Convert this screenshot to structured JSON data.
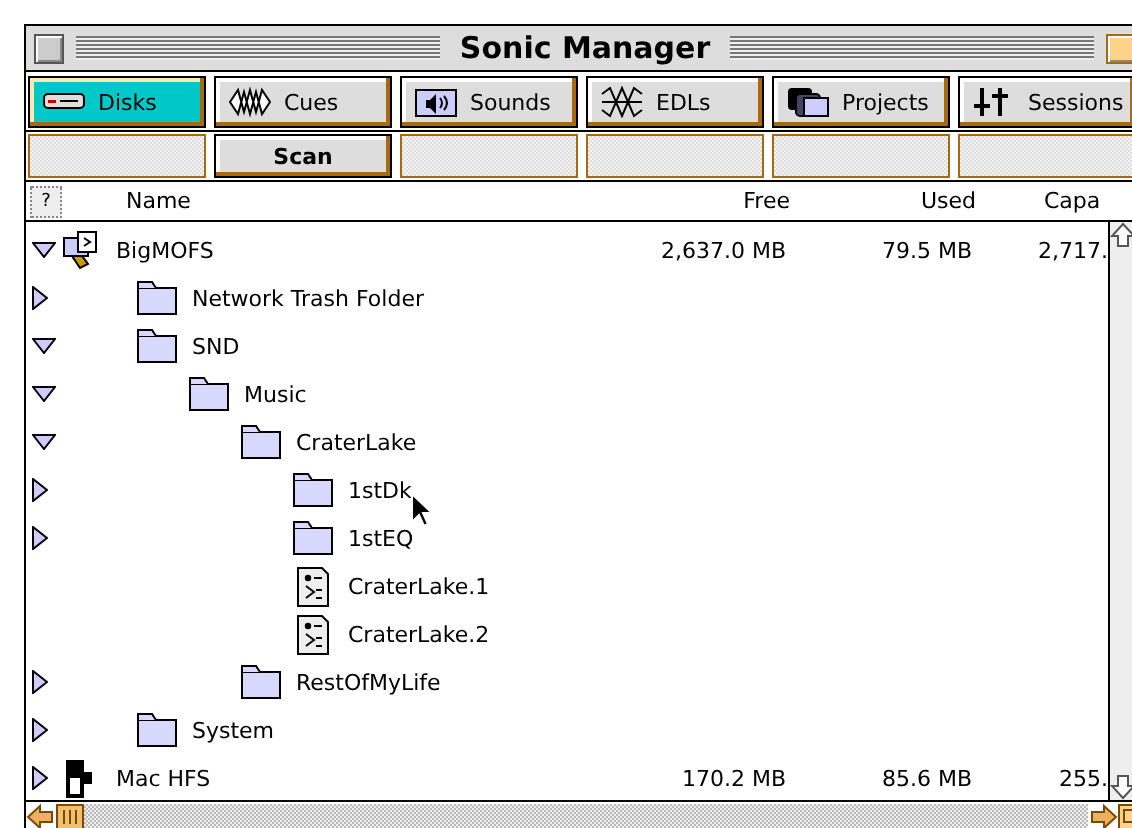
{
  "window": {
    "title": "Sonic Manager"
  },
  "tabs": [
    {
      "label": "Disks",
      "selected": true
    },
    {
      "label": "Cues",
      "selected": false
    },
    {
      "label": "Sounds",
      "selected": false
    },
    {
      "label": "EDLs",
      "selected": false
    },
    {
      "label": "Projects",
      "selected": false
    },
    {
      "label": "Sessions",
      "selected": false
    }
  ],
  "scan_button": {
    "label": "Scan"
  },
  "help_button": {
    "label": "?"
  },
  "columns": [
    "Name",
    "Free",
    "Used",
    "Capa"
  ],
  "tree": [
    {
      "name": "BigMOFS",
      "kind": "disk",
      "expanded": true,
      "free": "2,637.0 MB",
      "used": "79.5 MB",
      "capacity": "2,717.",
      "children": [
        {
          "name": "Network Trash Folder",
          "kind": "folder",
          "expanded": false
        },
        {
          "name": "SND",
          "kind": "folder",
          "expanded": true,
          "children": [
            {
              "name": "Music",
              "kind": "folder",
              "expanded": true,
              "children": [
                {
                  "name": "CraterLake",
                  "kind": "folder",
                  "expanded": true,
                  "children": [
                    {
                      "name": "1stDk",
                      "kind": "folder",
                      "expanded": false
                    },
                    {
                      "name": "1stEQ",
                      "kind": "folder",
                      "expanded": false
                    },
                    {
                      "name": "CraterLake.1",
                      "kind": "document"
                    },
                    {
                      "name": "CraterLake.2",
                      "kind": "document"
                    }
                  ]
                },
                {
                  "name": "RestOfMyLife",
                  "kind": "folder",
                  "expanded": false
                }
              ]
            }
          ]
        },
        {
          "name": "System",
          "kind": "folder",
          "expanded": false
        }
      ]
    },
    {
      "name": "Mac HFS",
      "kind": "drive",
      "expanded": false,
      "free": "170.2 MB",
      "used": "85.6 MB",
      "capacity": "255."
    }
  ]
}
